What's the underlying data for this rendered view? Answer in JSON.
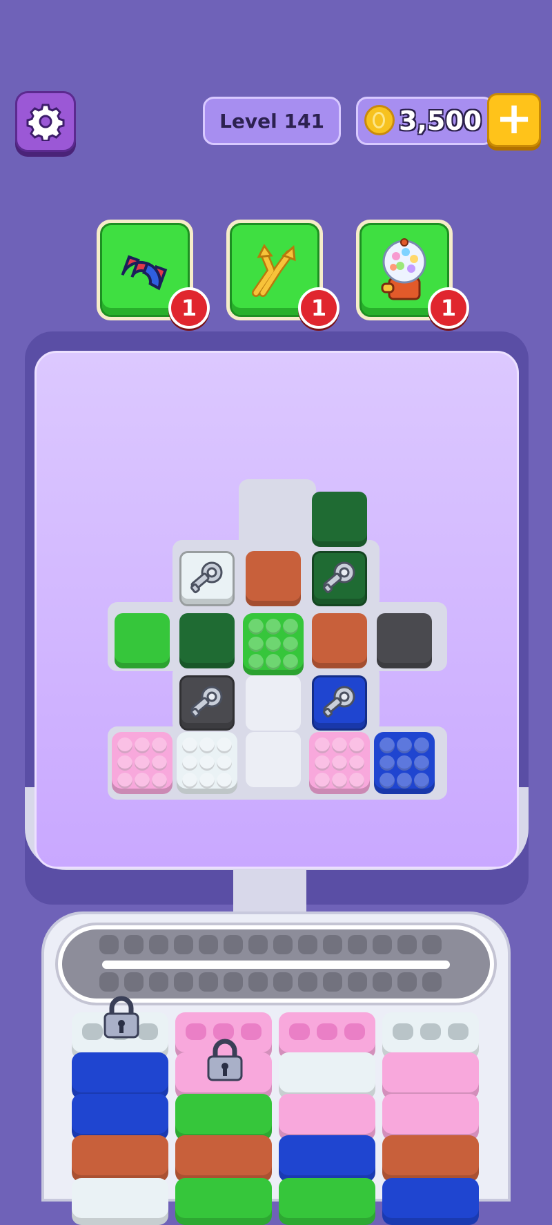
{
  "header": {
    "level_label": "Level 141",
    "coins": "3,500",
    "add_coins_label": "+"
  },
  "boosters": [
    {
      "name": "magnet",
      "icon": "magnet-icon",
      "count": "1"
    },
    {
      "name": "shuffle",
      "icon": "shuffle-arrows-icon",
      "count": "1"
    },
    {
      "name": "gumball",
      "icon": "gumball-machine-icon",
      "count": "1"
    }
  ],
  "colors": {
    "dark_green": "#1f6b33",
    "green": "#36c63b",
    "orange": "#c8603b",
    "gray": "#4a4a4f",
    "pink": "#f8a8dc",
    "white": "#eaf2f5",
    "blue": "#1f45d0"
  },
  "board": {
    "blocks": [
      {
        "row": 0,
        "col": 3,
        "color": "dark_green",
        "type": "flat"
      },
      {
        "row": 1,
        "col": 1,
        "color": "white",
        "type": "key"
      },
      {
        "row": 1,
        "col": 2,
        "color": "orange",
        "type": "flat"
      },
      {
        "row": 1,
        "col": 3,
        "color": "dark_green",
        "type": "key"
      },
      {
        "row": 2,
        "col": 0,
        "color": "green",
        "type": "flat"
      },
      {
        "row": 2,
        "col": 1,
        "color": "dark_green",
        "type": "flat"
      },
      {
        "row": 2,
        "col": 2,
        "color": "green",
        "type": "pop"
      },
      {
        "row": 2,
        "col": 3,
        "color": "orange",
        "type": "flat"
      },
      {
        "row": 2,
        "col": 4,
        "color": "gray",
        "type": "flat"
      },
      {
        "row": 3,
        "col": 1,
        "color": "gray",
        "type": "key"
      },
      {
        "row": 3,
        "col": 2,
        "color": "empty",
        "type": "empty"
      },
      {
        "row": 3,
        "col": 3,
        "color": "blue",
        "type": "key"
      },
      {
        "row": 4,
        "col": 0,
        "color": "pink",
        "type": "pop"
      },
      {
        "row": 4,
        "col": 1,
        "color": "white",
        "type": "pop"
      },
      {
        "row": 4,
        "col": 2,
        "color": "empty",
        "type": "empty"
      },
      {
        "row": 4,
        "col": 3,
        "color": "pink",
        "type": "pop"
      },
      {
        "row": 4,
        "col": 4,
        "color": "blue",
        "type": "pop"
      }
    ]
  },
  "tubes": [
    {
      "locked": true,
      "slabs": [
        "white",
        "blue",
        "blue",
        "orange",
        "white"
      ]
    },
    {
      "locked": true,
      "slabs": [
        "pink",
        "pink",
        "green",
        "orange",
        "green"
      ]
    },
    {
      "locked": false,
      "slabs": [
        "pink",
        "white",
        "pink",
        "blue",
        "green"
      ]
    },
    {
      "locked": false,
      "slabs": [
        "white",
        "pink",
        "pink",
        "orange",
        "blue"
      ]
    }
  ]
}
